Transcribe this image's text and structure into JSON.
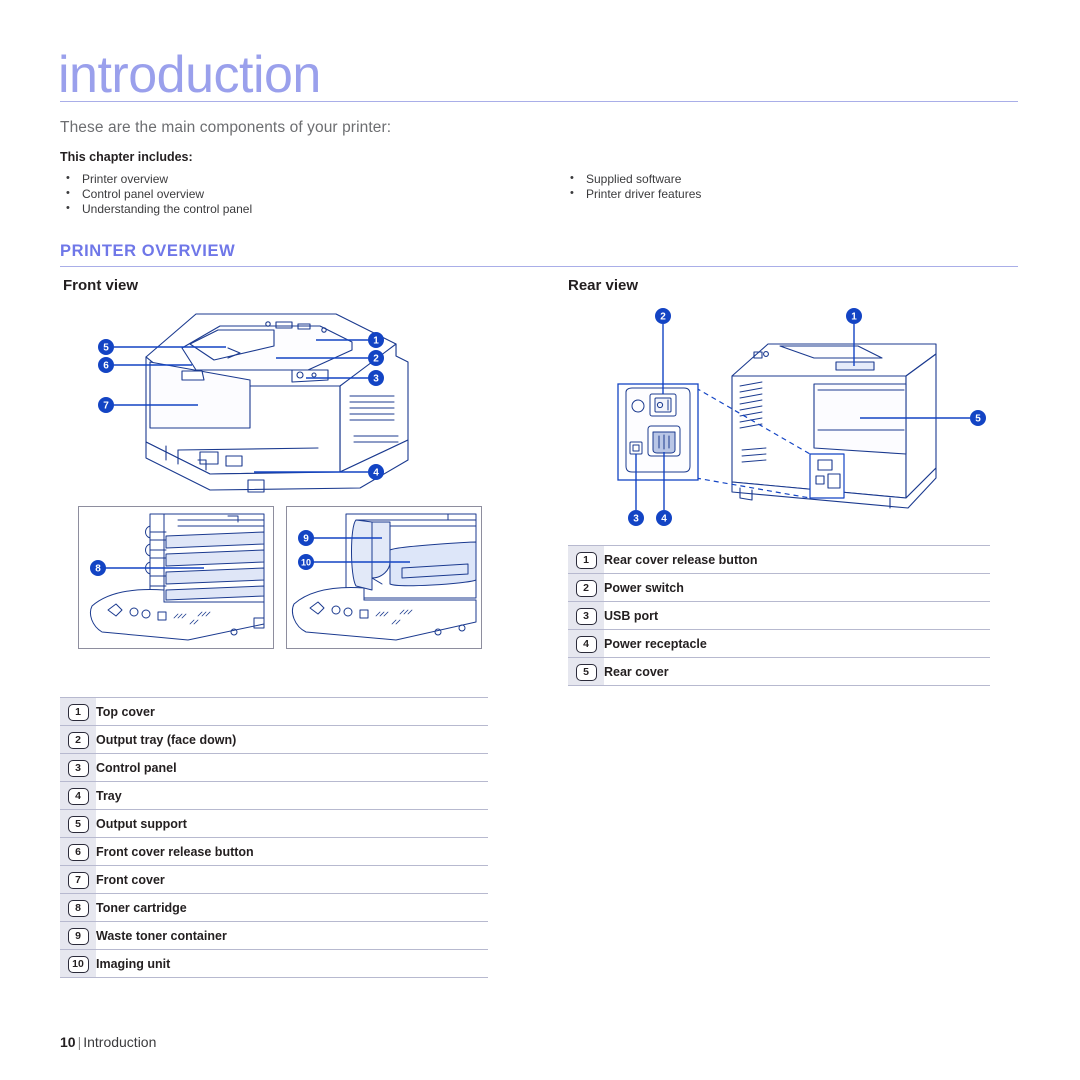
{
  "page": {
    "chapter_title": "introduction",
    "lead_text": "These are the main components of your printer:",
    "includes_label": "This chapter includes:",
    "includes_left": [
      "Printer overview",
      "Control panel overview",
      "Understanding the control panel"
    ],
    "includes_right": [
      "Supplied software",
      "Printer driver features"
    ],
    "section_heading": "PRINTER OVERVIEW",
    "footer_page_number": "10",
    "footer_separator": "|",
    "footer_chapter": "Introduction"
  },
  "colors": {
    "title_lavender": "#9aa0ec",
    "heading_blue": "#6f77e8",
    "rule_blue": "#a9aee8",
    "callout_blue": "#1344c4",
    "line_art_blue": "#1b3a8f",
    "badge_column_bg": "#e6e7ef",
    "body_text": "#231f20",
    "lead_text_gray": "#6d6e71"
  },
  "front_view": {
    "heading": "Front view",
    "callouts": [
      {
        "n": "1",
        "label": "Top cover"
      },
      {
        "n": "2",
        "label": "Output tray (face down)"
      },
      {
        "n": "3",
        "label": "Control panel"
      },
      {
        "n": "4",
        "label": "Tray"
      },
      {
        "n": "5",
        "label": "Output support"
      },
      {
        "n": "6",
        "label": "Front cover release button"
      },
      {
        "n": "7",
        "label": "Front cover"
      },
      {
        "n": "8",
        "label": "Toner cartridge"
      },
      {
        "n": "9",
        "label": "Waste toner container"
      },
      {
        "n": "10",
        "label": "Imaging unit"
      }
    ],
    "figure_markers": [
      "1",
      "2",
      "3",
      "4",
      "5",
      "6",
      "7"
    ],
    "detail_markers_left": [
      "8"
    ],
    "detail_markers_right": [
      "9",
      "10"
    ]
  },
  "rear_view": {
    "heading": "Rear view",
    "callouts": [
      {
        "n": "1",
        "label": "Rear cover release button"
      },
      {
        "n": "2",
        "label": "Power switch"
      },
      {
        "n": "3",
        "label": "USB port"
      },
      {
        "n": "4",
        "label": "Power receptacle"
      },
      {
        "n": "5",
        "label": "Rear cover"
      }
    ],
    "figure_markers": [
      "1",
      "2",
      "3",
      "4",
      "5"
    ]
  }
}
